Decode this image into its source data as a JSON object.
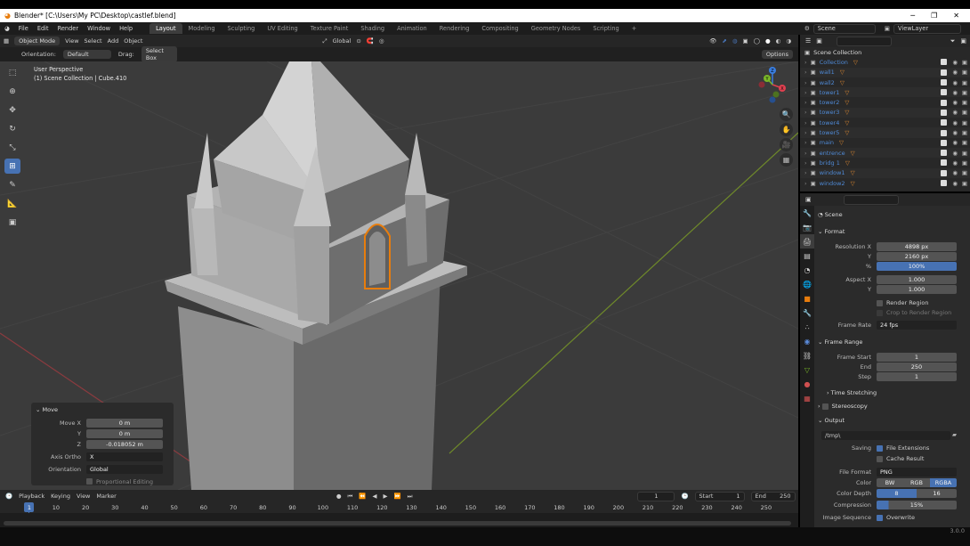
{
  "window": {
    "title": "Blender* [C:\\Users\\My PC\\Desktop\\castlef.blend]",
    "minimize": "─",
    "maximize": "❐",
    "close": "✕"
  },
  "menu": {
    "items": [
      "File",
      "Edit",
      "Render",
      "Window",
      "Help"
    ],
    "workspaces": [
      "Layout",
      "Modeling",
      "Sculpting",
      "UV Editing",
      "Texture Paint",
      "Shading",
      "Animation",
      "Rendering",
      "Compositing",
      "Geometry Nodes",
      "Scripting"
    ],
    "add_workspace": "+",
    "scene": "Scene",
    "view_layer": "ViewLayer"
  },
  "viewport_header": {
    "mode": "Object Mode",
    "menus": [
      "View",
      "Select",
      "Add",
      "Object"
    ],
    "transform": "Global"
  },
  "tool_header": {
    "orientation_label": "Orientation:",
    "orientation_value": "Default",
    "drag_label": "Drag:",
    "drag_value": "Select Box",
    "options": "Options"
  },
  "viewport": {
    "view_name": "User Perspective",
    "collection": "(1) Scene Collection | Cube.410"
  },
  "gizmo": {
    "x": "X",
    "y": "Y",
    "z": "Z"
  },
  "operator_panel": {
    "title": "Move",
    "move_x_label": "Move X",
    "move_x": "0 m",
    "y_label": "Y",
    "y": "0 m",
    "z_label": "Z",
    "z": "-0.018052 m",
    "axis_ortho_label": "Axis Ortho",
    "axis_ortho": "X",
    "orientation_label": "Orientation",
    "orientation": "Global",
    "proportional": "Proportional Editing"
  },
  "timeline": {
    "menus": [
      "Playback",
      "Keying",
      "View",
      "Marker"
    ],
    "current_frame": "1",
    "start_label": "Start",
    "start": "1",
    "end_label": "End",
    "end": "250",
    "ticks": [
      "1",
      "10",
      "20",
      "30",
      "40",
      "50",
      "60",
      "70",
      "80",
      "90",
      "100",
      "110",
      "120",
      "130",
      "140",
      "150",
      "160",
      "170",
      "180",
      "190",
      "200",
      "210",
      "220",
      "230",
      "240",
      "250"
    ]
  },
  "outliner": {
    "root": "Scene Collection",
    "items": [
      "Collection",
      "wall1",
      "wall2",
      "tower1",
      "tower2",
      "tower3",
      "tower4",
      "tower5",
      "main",
      "entrence",
      "bridg 1",
      "window1",
      "window2"
    ]
  },
  "properties": {
    "breadcrumb": "Scene",
    "format": {
      "title": "Format",
      "res_x_label": "Resolution X",
      "res_x": "4898 px",
      "res_y_label": "Y",
      "res_y": "2160 px",
      "pct_label": "%",
      "pct": "100%",
      "aspect_x_label": "Aspect X",
      "aspect_x": "1.000",
      "aspect_y_label": "Y",
      "aspect_y": "1.000",
      "render_region": "Render Region",
      "crop": "Crop to Render Region",
      "frame_rate_label": "Frame Rate",
      "frame_rate": "24 fps"
    },
    "frame_range": {
      "title": "Frame Range",
      "start_label": "Frame Start",
      "start": "1",
      "end_label": "End",
      "end": "250",
      "step_label": "Step",
      "step": "1"
    },
    "time_stretching": "Time Stretching",
    "stereoscopy": "Stereoscopy",
    "output": {
      "title": "Output",
      "path": "/tmp\\",
      "saving_label": "Saving",
      "file_ext": "File Extensions",
      "cache": "Cache Result",
      "file_format_label": "File Format",
      "file_format": "PNG",
      "color_label": "Color",
      "bw": "BW",
      "rgb": "RGB",
      "rgba": "RGBA",
      "depth_label": "Color Depth",
      "depth_8": "8",
      "depth_16": "16",
      "compression_label": "Compression",
      "compression": "15%",
      "image_seq_label": "Image Sequence",
      "overwrite": "Overwrite"
    }
  },
  "status": {
    "version": "3.0.0"
  },
  "colors": {
    "accent": "#4772b3",
    "selection": "#e87d0d",
    "x_axis": "#e04050",
    "y_axis": "#7ab828",
    "z_axis": "#3a7ee0"
  }
}
